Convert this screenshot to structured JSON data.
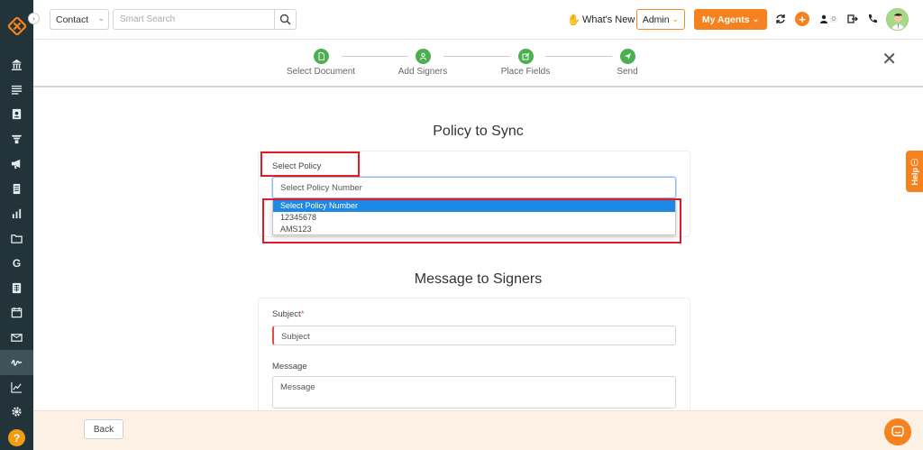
{
  "topbar": {
    "contact_select": "Contact",
    "search_placeholder": "Smart Search",
    "whats_new": "What's New",
    "admin": "Admin",
    "my_agents": "My Agents",
    "notification_count": "0"
  },
  "stepper": {
    "steps": [
      {
        "label": "Select Document"
      },
      {
        "label": "Add Signers"
      },
      {
        "label": "Place Fields"
      },
      {
        "label": "Send"
      }
    ]
  },
  "policy": {
    "title": "Policy to Sync",
    "select_label": "Select Policy",
    "select_value": "Select Policy Number",
    "options": [
      "Select Policy Number",
      "12345678",
      "AMS123"
    ]
  },
  "message": {
    "title": "Message to Signers",
    "subject_label": "Subject",
    "subject_required": "*",
    "subject_placeholder": "Subject",
    "message_label": "Message",
    "message_placeholder": "Message"
  },
  "help_tab": "Help",
  "footer": {
    "back": "Back"
  },
  "colors": {
    "sidebar": "#22343a",
    "accent": "#f5821f",
    "step_complete": "#4caf50",
    "highlight": "#e01b24",
    "selected_option": "#1e88e5"
  },
  "sidebar_icons": [
    "home-icon",
    "list-icon",
    "contacts-icon",
    "funnel-icon",
    "megaphone-icon",
    "document-icon",
    "bar-chart-icon",
    "folder-icon",
    "google-icon",
    "calendar-grid-icon",
    "calendar-icon",
    "mail-icon",
    "signature-icon",
    "trend-chart-icon",
    "gear-icon",
    "help-icon"
  ]
}
